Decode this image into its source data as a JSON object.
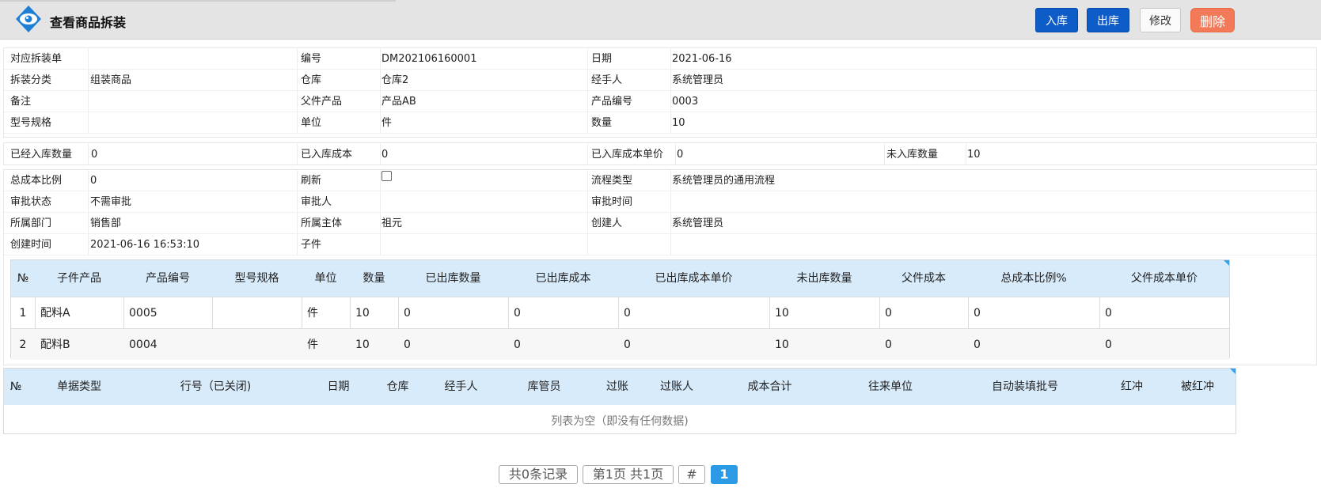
{
  "header": {
    "title": "查看商品拆装",
    "buttons": {
      "in": "入库",
      "out": "出库",
      "edit": "修改",
      "delete": "删除"
    }
  },
  "form1": {
    "rows": [
      [
        {
          "label": "对应拆装单",
          "value": ""
        },
        {
          "label": "编号",
          "value": "DM202106160001"
        },
        {
          "label": "日期",
          "value": "2021-06-16"
        }
      ],
      [
        {
          "label": "拆装分类",
          "value": "组装商品"
        },
        {
          "label": "仓库",
          "value": "仓库2"
        },
        {
          "label": "经手人",
          "value": "系统管理员"
        }
      ],
      [
        {
          "label": "备注",
          "value": ""
        },
        {
          "label": "父件产品",
          "value": "产品AB"
        },
        {
          "label": "产品编号",
          "value": "0003"
        }
      ],
      [
        {
          "label": "型号规格",
          "value": ""
        },
        {
          "label": "单位",
          "value": "件"
        },
        {
          "label": "数量",
          "value": "10"
        }
      ]
    ]
  },
  "form2": {
    "items": [
      {
        "label": "已经入库数量",
        "value": "0"
      },
      {
        "label": "已入库成本",
        "value": "0"
      },
      {
        "label": "已入库成本单价",
        "value": "0"
      },
      {
        "label": "未入库数量",
        "value": "10"
      }
    ]
  },
  "form3": {
    "rows": [
      [
        {
          "label": "总成本比例",
          "value": "0"
        },
        {
          "label": "刷新",
          "value": ""
        },
        {
          "label": "流程类型",
          "value": "系统管理员的通用流程"
        }
      ],
      [
        {
          "label": "审批状态",
          "value": "不需审批"
        },
        {
          "label": "审批人",
          "value": ""
        },
        {
          "label": "审批时间",
          "value": ""
        }
      ],
      [
        {
          "label": "所属部门",
          "value": "销售部"
        },
        {
          "label": "所属主体",
          "value": "祖元"
        },
        {
          "label": "创建人",
          "value": "系统管理员"
        }
      ],
      [
        {
          "label": "创建时间",
          "value": "2021-06-16 16:53:10"
        },
        {
          "label": "子件",
          "value": ""
        },
        {
          "label": "",
          "value": ""
        }
      ]
    ]
  },
  "child_table": {
    "headers": [
      "№",
      "子件产品",
      "产品编号",
      "型号规格",
      "单位",
      "数量",
      "已出库数量",
      "已出库成本",
      "已出库成本单价",
      "未出库数量",
      "父件成本",
      "总成本比例%",
      "父件成本单价"
    ],
    "rows": [
      [
        "1",
        "配料A",
        "0005",
        "",
        "件",
        "10",
        "0",
        "0",
        "0",
        "10",
        "0",
        "0",
        "0"
      ],
      [
        "2",
        "配料B",
        "0004",
        "",
        "件",
        "10",
        "0",
        "0",
        "0",
        "10",
        "0",
        "0",
        "0"
      ]
    ]
  },
  "record_table": {
    "headers": [
      "№",
      "单据类型",
      "行号（已关闭)",
      "日期",
      "仓库",
      "经手人",
      "库管员",
      "过账",
      "过账人",
      "成本合计",
      "往来单位",
      "自动装填批号",
      "红冲",
      "被红冲"
    ],
    "empty_text": "列表为空（即没有任何数据)"
  },
  "pager": {
    "total": "共0条记录",
    "page": "第1页 共1页",
    "hash": "#",
    "current": "1"
  }
}
